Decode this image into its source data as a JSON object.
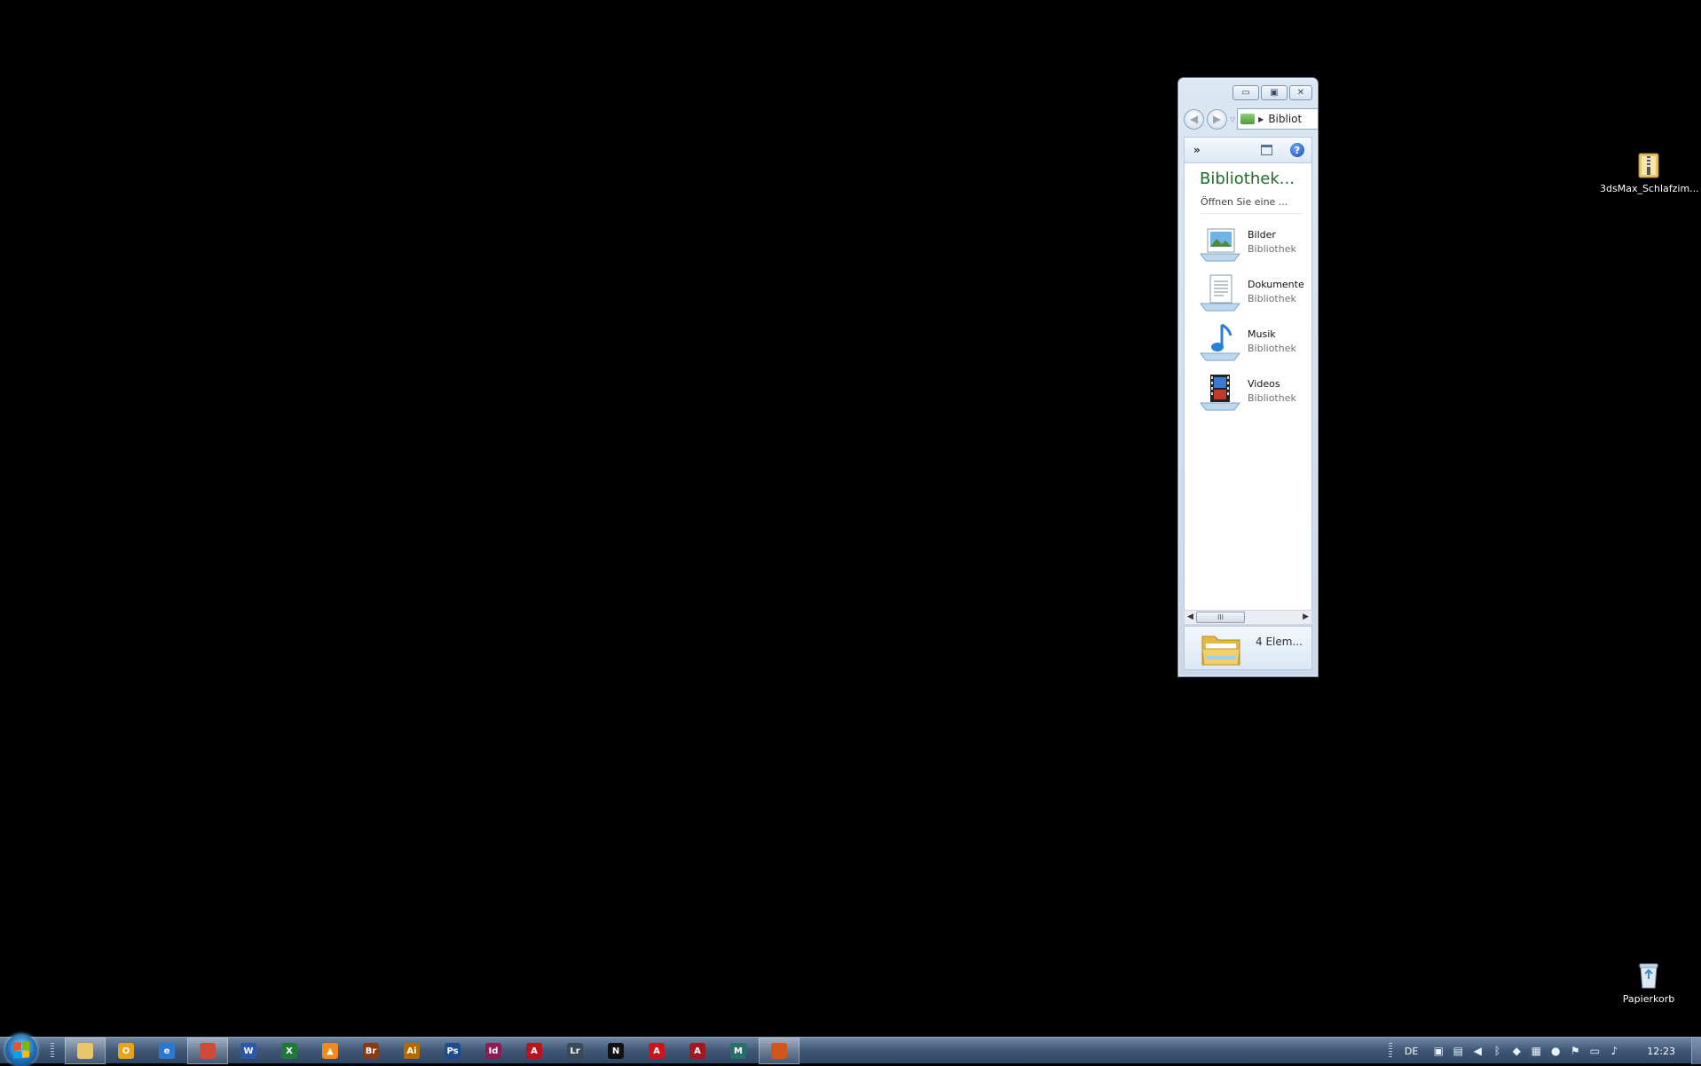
{
  "desktop": {
    "icons": [
      {
        "label": "3dsMax_Schlafzim..."
      },
      {
        "label": "Papierkorb"
      }
    ]
  },
  "window": {
    "caption_buttons": {
      "minimize": "▭",
      "maximize": "▣",
      "close": "✕"
    },
    "address": "Bibliot",
    "toolbar": {
      "more": "»",
      "help": "?"
    },
    "library_title": "Bibliothek...",
    "library_subtitle": "Öffnen Sie eine ...",
    "items": [
      {
        "name": "Bilder",
        "type": "Bibliothek",
        "icon": "pictures-library-icon"
      },
      {
        "name": "Dokumente",
        "type": "Bibliothek",
        "icon": "documents-library-icon"
      },
      {
        "name": "Musik",
        "type": "Bibliothek",
        "icon": "music-library-icon"
      },
      {
        "name": "Videos",
        "type": "Bibliothek",
        "icon": "videos-library-icon"
      }
    ],
    "scroll_grip": "III",
    "status_count": "4 Elem..."
  },
  "taskbar": {
    "apps": [
      {
        "label": "",
        "icon": "explorer-icon",
        "color": "#e8c66a",
        "running": true
      },
      {
        "label": "O",
        "icon": "outlook-icon",
        "color": "#e9a31b",
        "running": false
      },
      {
        "label": "e",
        "icon": "internet-explorer-icon",
        "color": "#2b78d0",
        "running": false
      },
      {
        "label": "",
        "icon": "chrome-icon",
        "color": "#d04a3a",
        "running": true
      },
      {
        "label": "W",
        "icon": "word-icon",
        "color": "#2c5aa8",
        "running": false
      },
      {
        "label": "X",
        "icon": "excel-icon",
        "color": "#1f7a3a",
        "running": false
      },
      {
        "label": "▲",
        "icon": "vlc-icon",
        "color": "#f08a1c",
        "running": false
      },
      {
        "label": "Br",
        "icon": "bridge-icon",
        "color": "#8a3a12",
        "running": false
      },
      {
        "label": "Ai",
        "icon": "illustrator-icon",
        "color": "#b26a00",
        "running": false
      },
      {
        "label": "Ps",
        "icon": "photoshop-icon",
        "color": "#1c4d8a",
        "running": false
      },
      {
        "label": "Id",
        "icon": "indesign-icon",
        "color": "#8a1d58",
        "running": false
      },
      {
        "label": "A",
        "icon": "acrobat-icon",
        "color": "#b8141c",
        "running": false
      },
      {
        "label": "Lr",
        "icon": "lightroom-icon",
        "color": "#3a4a5a",
        "running": false
      },
      {
        "label": "N",
        "icon": "nero-icon",
        "color": "#111111",
        "running": false
      },
      {
        "label": "A",
        "icon": "acrobat-reader-icon",
        "color": "#c8161e",
        "running": false
      },
      {
        "label": "A",
        "icon": "autocad-icon",
        "color": "#a01820",
        "running": false
      },
      {
        "label": "M",
        "icon": "max-icon",
        "color": "#2a6e6a",
        "running": false
      },
      {
        "label": "",
        "icon": "recorder-icon",
        "color": "#d2561c",
        "running": true
      }
    ],
    "tray": {
      "language": "DE",
      "icons": [
        "network-icon",
        "monitor-icon",
        "volume-icon",
        "bluetooth-icon",
        "usb-icon",
        "graph-icon",
        "ring-icon",
        "flag-icon",
        "display-icon",
        "speaker-icon"
      ],
      "clock": "12:23"
    }
  }
}
